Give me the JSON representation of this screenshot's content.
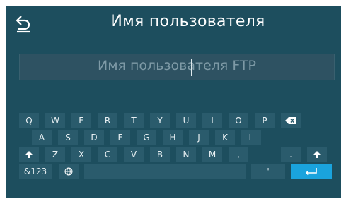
{
  "header": {
    "title": "Имя пользователя",
    "back_icon": "back-arrow-icon"
  },
  "input": {
    "placeholder": "Имя пользователя FTP"
  },
  "keyboard": {
    "row1": [
      "Q",
      "W",
      "E",
      "R",
      "T",
      "Y",
      "U",
      "I",
      "O",
      "P"
    ],
    "row2": [
      "A",
      "S",
      "D",
      "F",
      "G",
      "H",
      "J",
      "K",
      "L"
    ],
    "row3": [
      "Z",
      "X",
      "C",
      "V",
      "B",
      "N",
      "M",
      ",",
      "."
    ],
    "numbers_label": "&123",
    "quote_label": "'",
    "icons": {
      "backspace": "backspace-icon",
      "shift": "shift-icon",
      "globe": "globe-icon",
      "enter": "enter-icon"
    }
  },
  "colors": {
    "background": "#1d4e5e",
    "key": "#2a5b6c",
    "enter_key": "#1aa3dd"
  }
}
